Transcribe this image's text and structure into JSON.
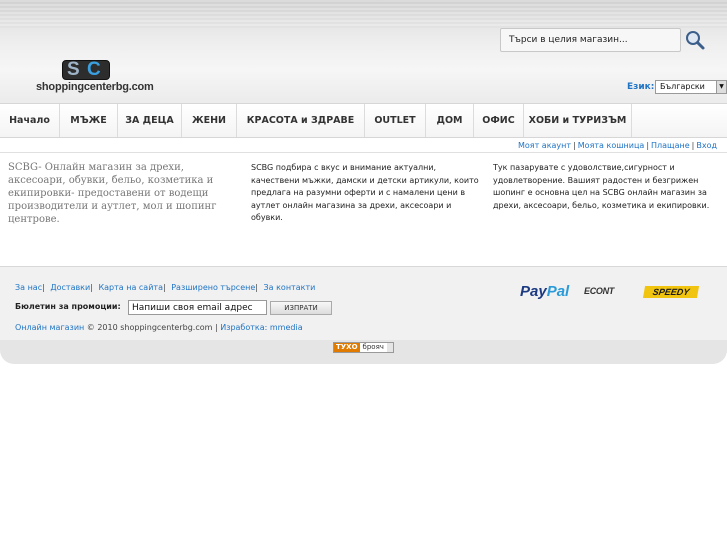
{
  "search": {
    "placeholder": "Търси в целия магазин..."
  },
  "logo": {
    "letters_1": "S",
    "letters_2": "C",
    "text": "shoppingcenterbg.com"
  },
  "language": {
    "label": "Език:",
    "selected": "Български"
  },
  "nav": {
    "items": [
      "Начало",
      "МЪЖЕ",
      "ЗА ДЕЦА",
      "ЖЕНИ",
      "КРАСОТА и ЗДРАВЕ",
      "OUTLET",
      "ДОМ",
      "ОФИС",
      "ХОБИ и ТУРИЗЪМ"
    ]
  },
  "account_links": [
    "Моят акаунт",
    "Моята кошница",
    "Плащане",
    "Вход"
  ],
  "content": {
    "col1": "SCBG- Онлайн магазин за дрехи, аксесоари, обувки, бельо, козметика и екипировки- предоставени от водещи производители и аутлет, мол и шопинг центрове.",
    "col2": "SCBG подбира с вкус и внимание актуални, качествени мъжки, дамски и детски артикули, които предлага на разумни оферти и с намалени цени в аутлет онлайн магазина за дрехи, аксесоари и обувки.",
    "col3": "Тук пазарувате с удоволствие,сигурност и удовлетворение. Вашият радостен и безгрижен шопинг е основна цел на SCBG онлайн магазин за дрехи, аксесоари, бельо, козметика и екипировки."
  },
  "footer": {
    "links": [
      "За нас",
      "Доставки",
      "Карта на сайта",
      "Разширено търсене",
      "За контакти"
    ],
    "newsletter_label": "Бюлетин за промоции:",
    "newsletter_value": "Напиши своя email адрес",
    "newsletter_button": "ИЗПРАТИ",
    "copyright_link": "Онлайн магазин",
    "copyright_text": " © 2010 shoppingcenterbg.com | ",
    "made_by": "Изработка: mmedia",
    "paypal_1": "Pay",
    "paypal_2": "Pal",
    "econt": "ECONT",
    "speedy": "SPEEDY",
    "counter_1": "ТУХО",
    "counter_2": "брояч"
  },
  "colors": {
    "link": "#1f74c6",
    "paypal_dark": "#1b3a82",
    "paypal_light": "#2a9bd8",
    "speedy": "#f1c40f"
  }
}
